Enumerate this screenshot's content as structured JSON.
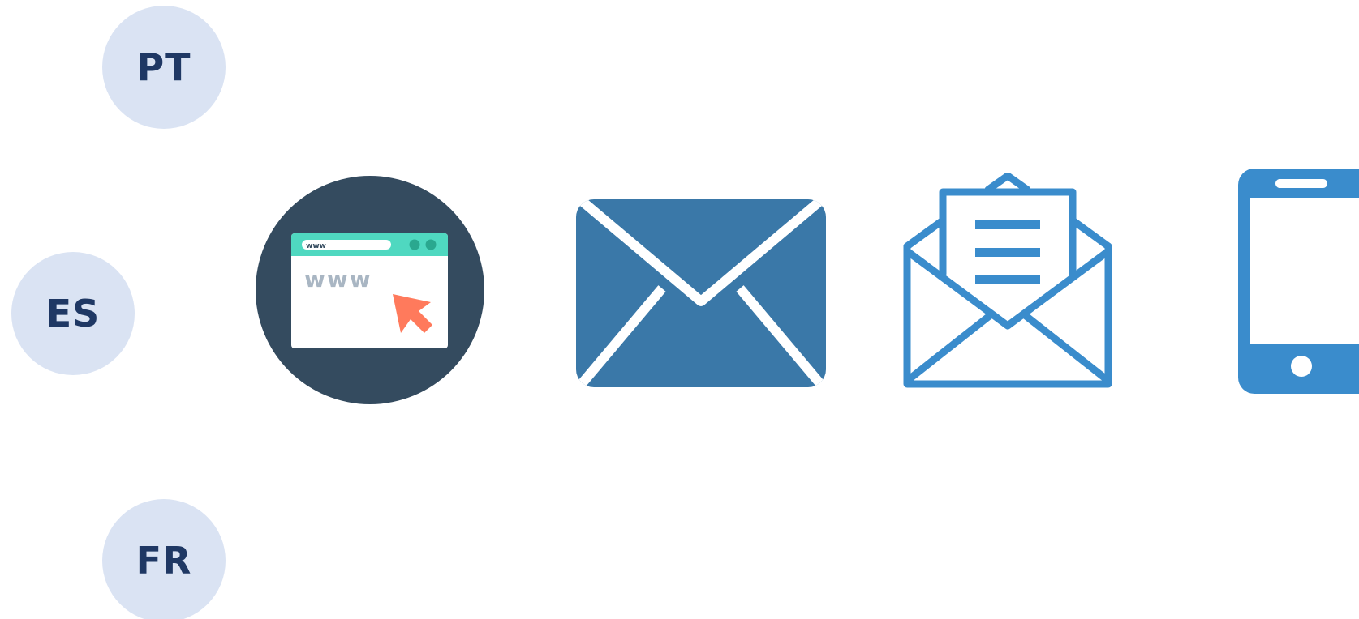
{
  "languages": [
    {
      "code": "PT"
    },
    {
      "code": "ES"
    },
    {
      "code": "FR"
    }
  ],
  "icons": {
    "website": {
      "name": "website-icon",
      "url_bar_text": "www",
      "page_text": "www"
    },
    "mail": {
      "name": "closed-envelope-icon"
    },
    "open_mail": {
      "name": "open-envelope-icon"
    },
    "phone": {
      "name": "mobile-phone-icon"
    }
  },
  "colors": {
    "badge_bg": "#dae3f3",
    "badge_text": "#1f3864",
    "web_circle": "#344b5f",
    "browser_bar": "#4fd8c0",
    "cursor": "#ff7a5c",
    "envelope": "#3a78a8",
    "outline_blue": "#3a8ccc"
  }
}
